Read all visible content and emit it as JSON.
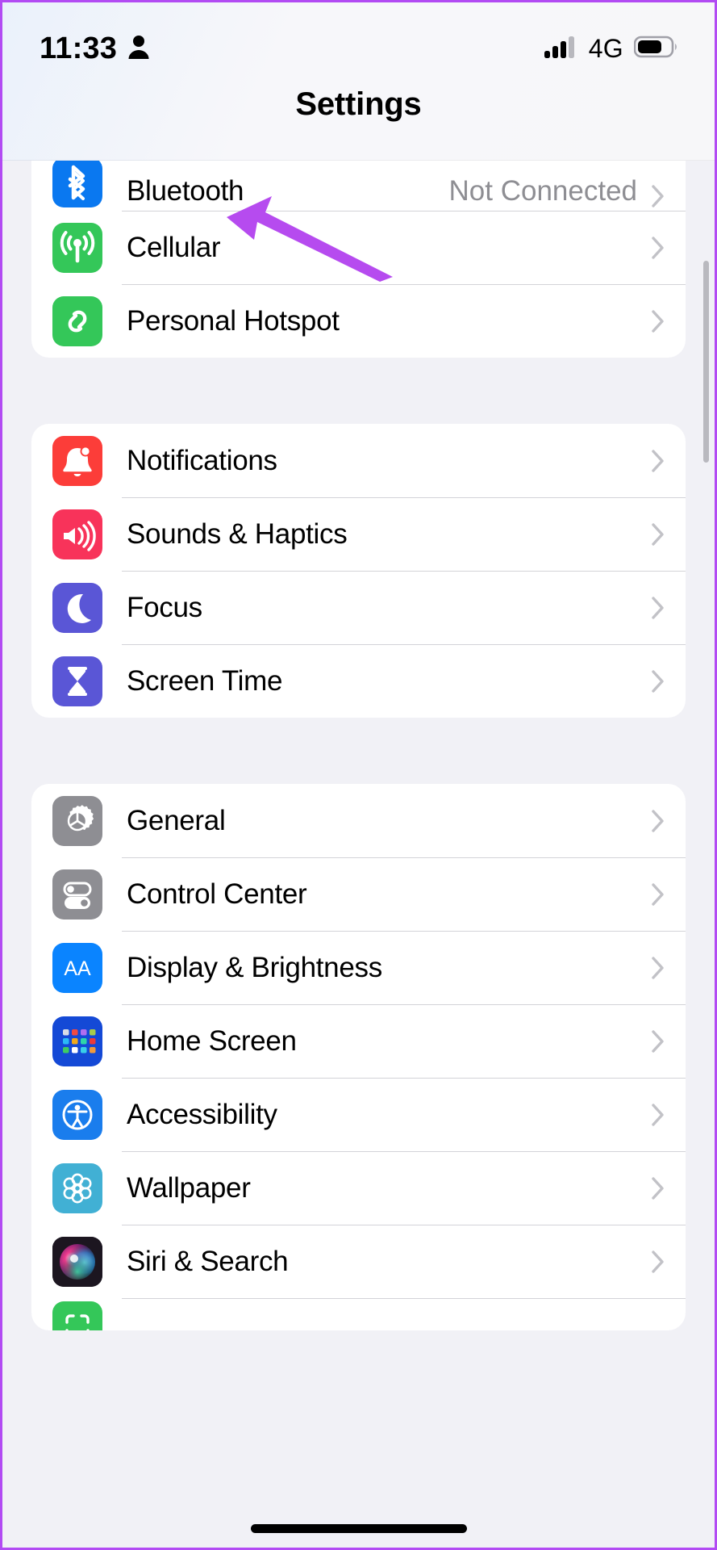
{
  "status_bar": {
    "time": "11:33",
    "location_icon": "person-icon",
    "network_label": "4G",
    "signal_icon": "cellular-signal-icon",
    "signal_bars_filled": 3,
    "signal_bars_total": 4,
    "battery_icon": "battery-icon",
    "battery_level_percent": 65
  },
  "header": {
    "title": "Settings"
  },
  "annotation": {
    "type": "arrow",
    "color": "#b64bef",
    "points_to": "Cellular"
  },
  "sections": [
    {
      "id": "connectivity",
      "rows": [
        {
          "label": "Bluetooth",
          "value": "Not Connected",
          "icon": "bluetooth-icon",
          "icon_color": "#0a78f0",
          "chevron": "chevron-right-icon",
          "clipped": true
        },
        {
          "label": "Cellular",
          "value": "",
          "icon": "cellular-antenna-icon",
          "icon_color": "#34c759",
          "chevron": "chevron-right-icon",
          "clipped": false
        },
        {
          "label": "Personal Hotspot",
          "value": "",
          "icon": "personal-hotspot-link-icon",
          "icon_color": "#34c759",
          "chevron": "chevron-right-icon",
          "clipped": false
        }
      ]
    },
    {
      "id": "alerts",
      "rows": [
        {
          "label": "Notifications",
          "value": "",
          "icon": "notifications-bell-icon",
          "icon_color": "#fc3d39",
          "chevron": "chevron-right-icon",
          "clipped": false
        },
        {
          "label": "Sounds & Haptics",
          "value": "",
          "icon": "sounds-speaker-icon",
          "icon_color": "#f8335a",
          "chevron": "chevron-right-icon",
          "clipped": false
        },
        {
          "label": "Focus",
          "value": "",
          "icon": "focus-moon-icon",
          "icon_color": "#5a56d6",
          "chevron": "chevron-right-icon",
          "clipped": false
        },
        {
          "label": "Screen Time",
          "value": "",
          "icon": "screen-time-hourglass-icon",
          "icon_color": "#5a56d6",
          "chevron": "chevron-right-icon",
          "clipped": false
        }
      ]
    },
    {
      "id": "system",
      "rows": [
        {
          "label": "General",
          "value": "",
          "icon": "general-gear-icon",
          "icon_color": "#8e8e93",
          "chevron": "chevron-right-icon",
          "clipped": false
        },
        {
          "label": "Control Center",
          "value": "",
          "icon": "control-center-toggles-icon",
          "icon_color": "#8e8e93",
          "chevron": "chevron-right-icon",
          "clipped": false
        },
        {
          "label": "Display & Brightness",
          "value": "",
          "icon": "display-brightness-aa-icon",
          "icon_color": "#0a84ff",
          "chevron": "chevron-right-icon",
          "clipped": false
        },
        {
          "label": "Home Screen",
          "value": "",
          "icon": "home-screen-grid-icon",
          "icon_color": "#1449d6",
          "chevron": "chevron-right-icon",
          "clipped": false
        },
        {
          "label": "Accessibility",
          "value": "",
          "icon": "accessibility-figure-icon",
          "icon_color": "#1a7ded",
          "chevron": "chevron-right-icon",
          "clipped": false
        },
        {
          "label": "Wallpaper",
          "value": "",
          "icon": "wallpaper-flower-icon",
          "icon_color": "#41b0d4",
          "chevron": "chevron-right-icon",
          "clipped": false
        },
        {
          "label": "Siri & Search",
          "value": "",
          "icon": "siri-orb-icon",
          "icon_color": "#2b2b33",
          "chevron": "chevron-right-icon",
          "clipped": false
        }
      ]
    }
  ],
  "partial_bottom_icon": {
    "icon": "face-id-passcode-icon",
    "icon_color": "#34c759"
  },
  "home_indicator": "home-indicator-bar"
}
